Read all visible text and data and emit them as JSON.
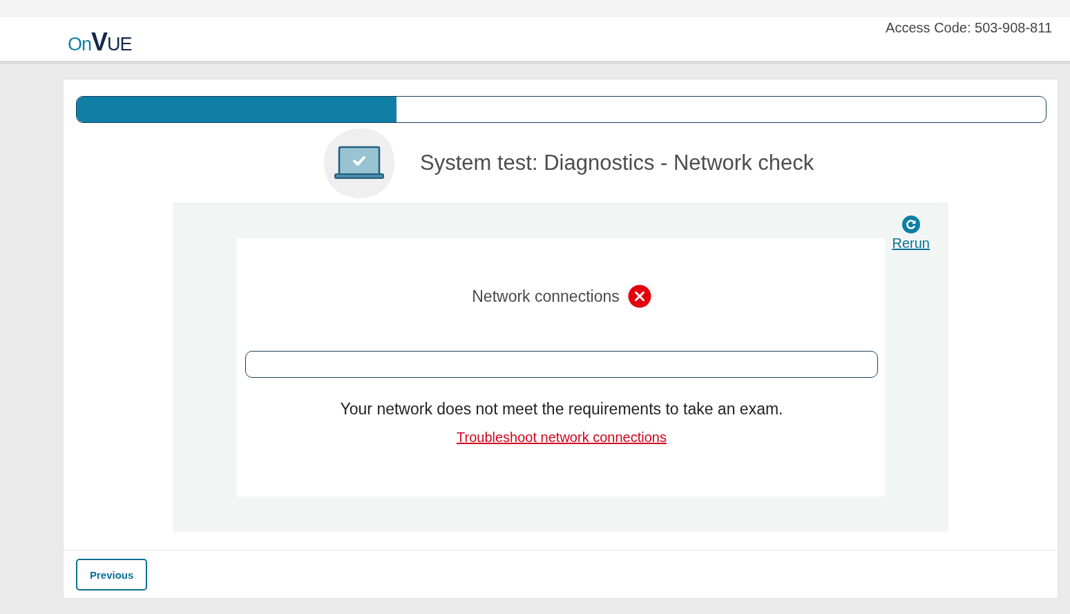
{
  "header": {
    "logo": [
      "On",
      "V",
      "UE"
    ],
    "access_code": "Access Code: 503-908-811"
  },
  "progress": {
    "level": 0.33
  },
  "title": "System test: Diagnostics - Network check",
  "rerun": {
    "label": "Rerun"
  },
  "check": {
    "label": "Network connections",
    "failed": true,
    "level": 0
  },
  "message": "Your network does not meet the requirements to take an exam.",
  "link": "Troubleshoot network connections",
  "buttons": [
    {
      "label": "Previous"
    }
  ]
}
